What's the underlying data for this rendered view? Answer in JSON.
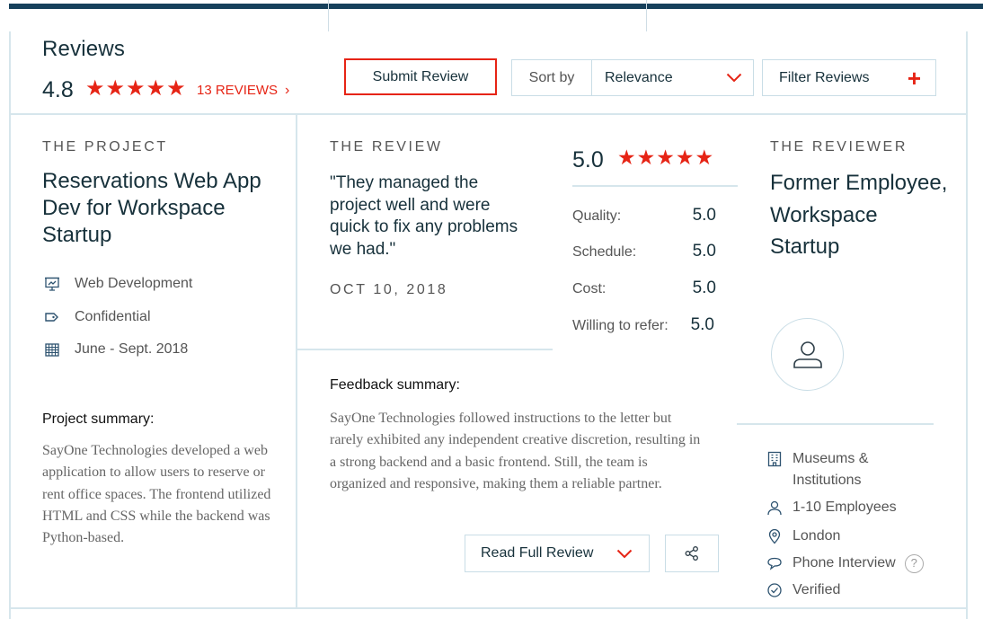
{
  "header": {
    "title": "Reviews",
    "rating": "4.8",
    "stars": "★★★★★",
    "review_count": "13 REVIEWS",
    "count_chevron": "›",
    "submit_label": "Submit Review",
    "sort_label": "Sort by",
    "sort_value": "Relevance",
    "filter_label": "Filter Reviews",
    "filter_plus": "+"
  },
  "review": {
    "project": {
      "section_label": "THE PROJECT",
      "title": "Reservations Web App Dev for Workspace Startup",
      "service": "Web Development",
      "budget": "Confidential",
      "dates": "June - Sept. 2018",
      "summary_heading": "Project summary:",
      "summary": "SayOne Technologies developed a web application to allow users to reserve or rent office spaces. The frontend utilized HTML and CSS while the backend was Python-based."
    },
    "review": {
      "section_label": "THE REVIEW",
      "quote": "\"They managed the project well and were quick to fix any problems we had.\"",
      "date": "OCT 10, 2018",
      "overall": "5.0",
      "stars": "★★★★★",
      "scores": [
        {
          "label": "Quality:",
          "value": "5.0"
        },
        {
          "label": "Schedule:",
          "value": "5.0"
        },
        {
          "label": "Cost:",
          "value": "5.0"
        },
        {
          "label": "Willing to refer:",
          "value": "5.0"
        }
      ],
      "feedback_heading": "Feedback summary:",
      "feedback": "SayOne Technologies followed instructions to the letter but rarely exhibited any independent creative discretion, resulting in a strong backend and a basic frontend. Still, the team is organized and responsive, making them a reliable partner.",
      "read_full_label": "Read Full Review"
    },
    "reviewer": {
      "section_label": "THE REVIEWER",
      "name": "Former Employee, Workspace Startup",
      "industry": "Museums & Institutions",
      "size": "1-10 Employees",
      "location": "London",
      "interview": "Phone Interview",
      "help": "?",
      "verified": "Verified"
    }
  },
  "colors": {
    "accent": "#e62415",
    "navy": "#16405b",
    "border": "#d6e6ec"
  },
  "icons": [
    "presentation-icon",
    "tag-icon",
    "calendar-icon",
    "chevron-down-icon",
    "share-icon",
    "user-icon",
    "building-icon",
    "person-icon",
    "location-pin-icon",
    "chat-bubble-icon",
    "help-icon",
    "check-circle-icon"
  ]
}
